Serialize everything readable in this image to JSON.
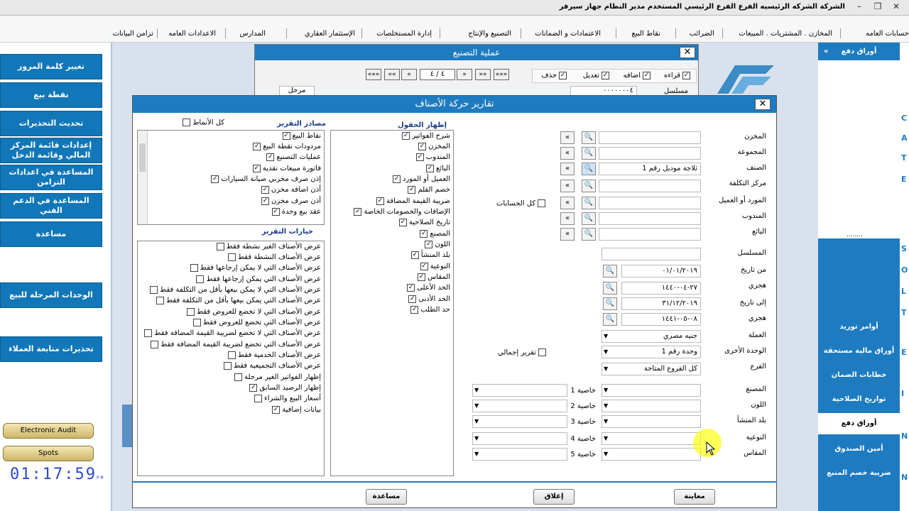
{
  "titlebar": {
    "text": "الشركة الشركه الرئيسيه   الفرع الفرع الرئيسي   المستخدم مدير النظام   جهاز سيرفر",
    "min": "–",
    "max": "❐",
    "close": "✕"
  },
  "menu": [
    "حسابات العامه",
    "المخازن . المشتريات . المبيعات",
    "الضرائب",
    "نقاط البيع",
    "الاعتمادات و الضمانات",
    "التصنيع والإنتاج",
    "إدارة المستخلصات",
    "الإستثمار العقاري",
    "المدارس",
    "الاعدادات العامه",
    "تزامن البيانات"
  ],
  "left_nav": [
    "تغيير كلمة المرور",
    "نقطة بيع",
    "تحديث التحذيرات",
    "إعدادات قائمة المركز المالي وقائمة الدخل",
    "المساعدة في اعدادات التزامن",
    "المساعدة في الدعم الفني",
    "مساعدة",
    "الوحدات المرحلة للبيع",
    "تحذيرات متابعة العملاء"
  ],
  "gold_buttons": [
    "Electronic Audit",
    "Spots"
  ],
  "clock": {
    "time": "01:17:59",
    "ampm": "PM"
  },
  "right_panel": {
    "header": "أوراق دفع",
    "collapse_icon": "»",
    "dots": "........",
    "items": [
      "أوامر توريد",
      "أوراق مالية مستحقة",
      "خطابات الضمان",
      "تواريخ الصلاحية",
      "أوراق دفع",
      "أمين الصندوق",
      "ضريبة خصم المنبع"
    ],
    "active_index": 4,
    "strip_chars": [
      "C",
      "A",
      "T",
      "E",
      "S",
      "O",
      "L",
      "T",
      "E",
      "I",
      "N",
      "N"
    ]
  },
  "mfg_window": {
    "title": "عملية التصنيع",
    "close": "✕",
    "page_indicator": "٤ / ٤",
    "nav": [
      "«««",
      "««",
      "«",
      "»",
      "»»",
      "»»»"
    ],
    "perms": [
      {
        "label": "قراءه",
        "checked": true
      },
      {
        "label": "اضافه",
        "checked": true
      },
      {
        "label": "تعديل",
        "checked": true
      },
      {
        "label": "حذف",
        "checked": true
      }
    ],
    "field_label": "مسلسل",
    "field_value": "٠٠٠٠٠٠٠٤",
    "status": "مرحل"
  },
  "report_window": {
    "title": "تقارير حركة الأصناف",
    "close": "✕",
    "labels": {
      "store": "المخزن",
      "group": "المجموعة",
      "item": "الصنف",
      "cost_center": "مركز التكلفة",
      "supplier": "المورد أو العميل",
      "rep": "المندوب",
      "seller": "البائع",
      "serial": "المسلسل",
      "from_date": "من تاريخ",
      "hijri1": "هجري",
      "to_date": "إلى تاريخ",
      "hijri2": "هجري",
      "currency": "العملة",
      "other_unit": "الوحدة الأخرى",
      "branch": "الفرع",
      "factory": "المصنع",
      "color": "اللون",
      "origin": "بلد المنشأ",
      "type": "النوعية",
      "size": "المقاس"
    },
    "values": {
      "item": "ثلاجة موديل رقم 1",
      "from_date": "٠١/٠١/٢٠١٩",
      "hijri1": "٢٧-٠٤-١٤٤٠",
      "to_date": "٣١/١٢/٢٠١٩",
      "hijri2": "٠٨-٠٥-١٤٤١",
      "currency": "جنيه مصري",
      "other_unit": "وحدة رقم 1",
      "branch": "كل الفروع المتاحة"
    },
    "all_accounts": "كل الحسابات",
    "summary_report": "تقرير إجمالي",
    "properties": [
      "خاصية 1",
      "خاصية 2",
      "خاصية 3",
      "خاصية 4",
      "خاصية 5"
    ],
    "show_fields_header": "إظهار الحقول",
    "show_fields": [
      "شرح الفواتير",
      "المخزن",
      "المندوب",
      "البائع",
      "العميل أو المورد",
      "خصم القلم",
      "ضريبة القيمة المضافة",
      "الإضافات والخصومات الخاصة",
      "تاريخ الصلاحية",
      "المصنع",
      "اللون",
      "بلد المنشأ",
      "النوعية",
      "المقاس",
      "الحد الأعلى",
      "الحد الأدنى",
      "حد الطلب"
    ],
    "sources_header": "مصادر التقرير",
    "all_patterns": "كل الأنماط",
    "sources": [
      "نقاط البيع",
      "مردودات نقطة البيع",
      "عمليات التصنيع",
      "فاتورة مبيعات نقدية",
      "إذن صرف مخزني صيانة السيارات",
      "أذن اضافة مخزن",
      "أذن صرف مخزن",
      "عقد بيع وحدة"
    ],
    "options_header": "خيارات التقرير",
    "options": [
      {
        "label": "عرض الأصناف الغير نشطة فقط",
        "checked": false
      },
      {
        "label": "عرض الأصناف النشطة فقط",
        "checked": false
      },
      {
        "label": "عرض الأصناف التي لا يمكن إرجاعها فقط",
        "checked": false
      },
      {
        "label": "عرض الأصناف التي يمكن إرجاعها فقط",
        "checked": false
      },
      {
        "label": "عرض الأصناف التي لا يمكن بيعها بأقل من التكلفة فقط",
        "checked": false
      },
      {
        "label": "عرض الأصناف التي يمكن بيعها بأقل من التكلفة فقط",
        "checked": false
      },
      {
        "label": "عرض الأصناف التي لا تخضع للعروض فقط",
        "checked": false
      },
      {
        "label": "عرض الأصناف التي تخضع للعروض فقط",
        "checked": false
      },
      {
        "label": "عرض الأصناف التي لا تخضع لضريبة القيمة المضافة فقط",
        "checked": false
      },
      {
        "label": "عرض الأصناف التي تخضع لضريبة القيمة المضافة فقط",
        "checked": false
      },
      {
        "label": "عرض الأصناف الخدمية فقط",
        "checked": false
      },
      {
        "label": "عرض الأصناف التجميعية فقط",
        "checked": false
      },
      {
        "label": "إظهار الفواتير الغير مرحلة",
        "checked": false
      },
      {
        "label": "إظهار الرصيد السابق",
        "checked": true
      },
      {
        "label": "أسعار البيع والشراء",
        "checked": false
      },
      {
        "label": "بيانات إضافية",
        "checked": true
      }
    ],
    "buttons": {
      "preview": "معاينة",
      "close": "إغلاق",
      "help": "مساعدة"
    }
  }
}
